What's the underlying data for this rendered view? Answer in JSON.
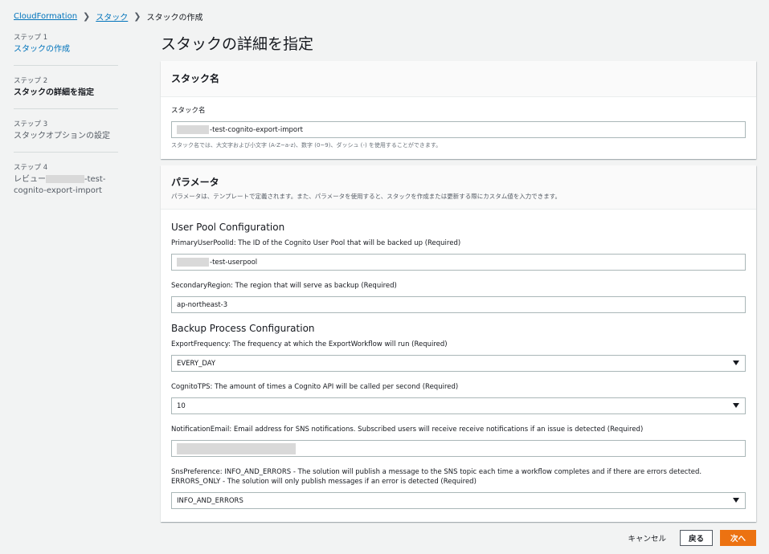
{
  "breadcrumb": {
    "items": [
      "CloudFormation",
      "スタック",
      "スタックの作成"
    ]
  },
  "steps": [
    {
      "num": "ステップ 1",
      "label": "スタックの作成"
    },
    {
      "num": "ステップ 2",
      "label": "スタックの詳細を指定"
    },
    {
      "num": "ステップ 3",
      "label": "スタックオプションの設定"
    },
    {
      "num": "ステップ 4",
      "label_prefix": "レビュー",
      "label_suffix": "-test-cognito-export-import"
    }
  ],
  "page_title": "スタックの詳細を指定",
  "stack_name_panel": {
    "title": "スタック名",
    "field_label": "スタック名",
    "value_suffix": "-test-cognito-export-import",
    "hint": "スタック名では、大文字および小文字 (A-Z~a-z)、数字 (0~9)、ダッシュ (-) を使用することができます。"
  },
  "params_panel": {
    "title": "パラメータ",
    "desc": "パラメータは、テンプレートで定義されます。また、パラメータを使用すると、スタックを作成または更新する際にカスタム値を入力できます。",
    "user_pool_heading": "User Pool Configuration",
    "primary_label": "PrimaryUserPoolId: The ID of the Cognito User Pool that will be backed up (Required)",
    "primary_value_suffix": "-test-userpool",
    "secondary_label": "SecondaryRegion: The region that will serve as backup (Required)",
    "secondary_value": "ap-northeast-3",
    "backup_heading": "Backup Process Configuration",
    "export_label": "ExportFrequency: The frequency at which the ExportWorkflow will run (Required)",
    "export_value": "EVERY_DAY",
    "tps_label": "CognitoTPS: The amount of times a Cognito API will be called per second (Required)",
    "tps_value": "10",
    "email_label": "NotificationEmail: Email address for SNS notifications. Subscribed users will receive receive notifications if an issue is detected (Required)",
    "sns_label": "SnsPreference: INFO_AND_ERRORS - The solution will publish a message to the SNS topic each time a workflow completes and if there are errors detected. ERRORS_ONLY - The solution will only publish messages if an error is detected (Required)",
    "sns_value": "INFO_AND_ERRORS"
  },
  "footer": {
    "cancel": "キャンセル",
    "back": "戻る",
    "next": "次へ"
  }
}
